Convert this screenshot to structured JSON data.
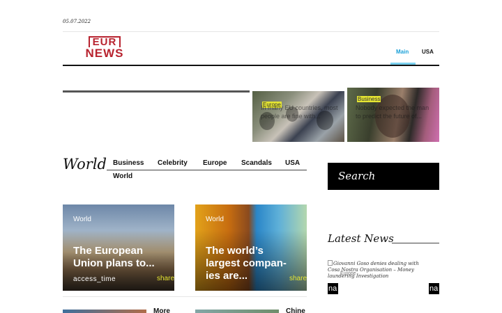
{
  "header": {
    "date": "05.07.2022",
    "logo_top": "EUR",
    "logo_bottom": "NEWS",
    "nav": {
      "main": "Main",
      "usa": "USA"
    }
  },
  "slider": {
    "items": [
      {
        "category": "Europe",
        "title": "In many EU countries, most people are fine with..."
      },
      {
        "category": "Business",
        "title": "Nobody expected the man to predict the future of..."
      }
    ]
  },
  "world": {
    "title": "World",
    "categories": [
      "Business",
      "Celebrity",
      "Europe",
      "Scandals",
      "USA",
      "World"
    ],
    "cards": [
      {
        "category": "World",
        "title": "The European Union plans to...",
        "time": "access_time",
        "share": "share"
      },
      {
        "category": "World",
        "title": "The world’s largest compan-ies are...",
        "time": "",
        "share": "share"
      }
    ],
    "more_cards": [
      {
        "title": "More"
      },
      {
        "title": "Chine"
      }
    ]
  },
  "sidebar": {
    "search_label": "Search",
    "latest_title": "Latest News",
    "latest_items": [
      {
        "image_alt": "Giovanni Goso denies dealing with Cosa Nostra Organisation – Money laundering Investigation",
        "category": "Europe"
      }
    ],
    "nav_left": "na",
    "nav_right": "na"
  },
  "colors": {
    "brand_red": "#b8232f",
    "nav_accent": "#1aa0d8",
    "category_highlight": "#e6e632"
  }
}
